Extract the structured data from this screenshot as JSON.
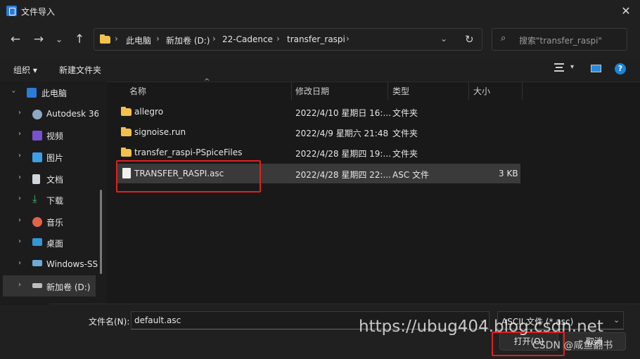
{
  "window": {
    "title": "文件导入",
    "close_symbol": "✕"
  },
  "nav": {
    "breadcrumb": [
      "此电脑",
      "新加卷 (D:)",
      "22-Cadence",
      "transfer_raspi"
    ],
    "search_placeholder": "搜索\"transfer_raspi\""
  },
  "toolbar": {
    "organize": "组织 ▾",
    "new_folder": "新建文件夹",
    "help": "?"
  },
  "sidebar": {
    "items": [
      {
        "label": "此电脑",
        "expanded": true
      },
      {
        "label": "Autodesk 36"
      },
      {
        "label": "视频"
      },
      {
        "label": "图片"
      },
      {
        "label": "文档"
      },
      {
        "label": "下载"
      },
      {
        "label": "音乐"
      },
      {
        "label": "桌面"
      },
      {
        "label": "Windows-SS"
      },
      {
        "label": "新加卷 (D:)",
        "selected": true
      }
    ]
  },
  "columns": {
    "name": "名称",
    "modified": "修改日期",
    "type": "类型",
    "size": "大小"
  },
  "files": [
    {
      "name": "allegro",
      "modified": "2022/4/10 星期日 16:...",
      "type": "文件夹",
      "size": "",
      "icon": "folder-icon"
    },
    {
      "name": "signoise.run",
      "modified": "2022/4/9 星期六 21:48",
      "type": "文件夹",
      "size": "",
      "icon": "folder-icon"
    },
    {
      "name": "transfer_raspi-PSpiceFiles",
      "modified": "2022/4/28 星期四 19:...",
      "type": "文件夹",
      "size": "",
      "icon": "folder-icon"
    },
    {
      "name": "TRANSFER_RASPI.asc",
      "modified": "2022/4/28 星期四 22:...",
      "type": "ASC 文件",
      "size": "3 KB",
      "icon": "file-icon",
      "selected": true
    }
  ],
  "footer": {
    "filename_label": "文件名(N):",
    "filename_value": "default.asc",
    "filter": "ASCII 文件 (*.asc)",
    "open_button": "打开(O)",
    "cancel_button": "取消"
  },
  "watermark": {
    "url": "https://ubug404.blog.csdn.net",
    "credit": "CSDN @咸鱼翻书"
  },
  "colors": {
    "accent": "#1a86d9",
    "highlight_box": "#e02020",
    "folder": "#f2c14d"
  }
}
